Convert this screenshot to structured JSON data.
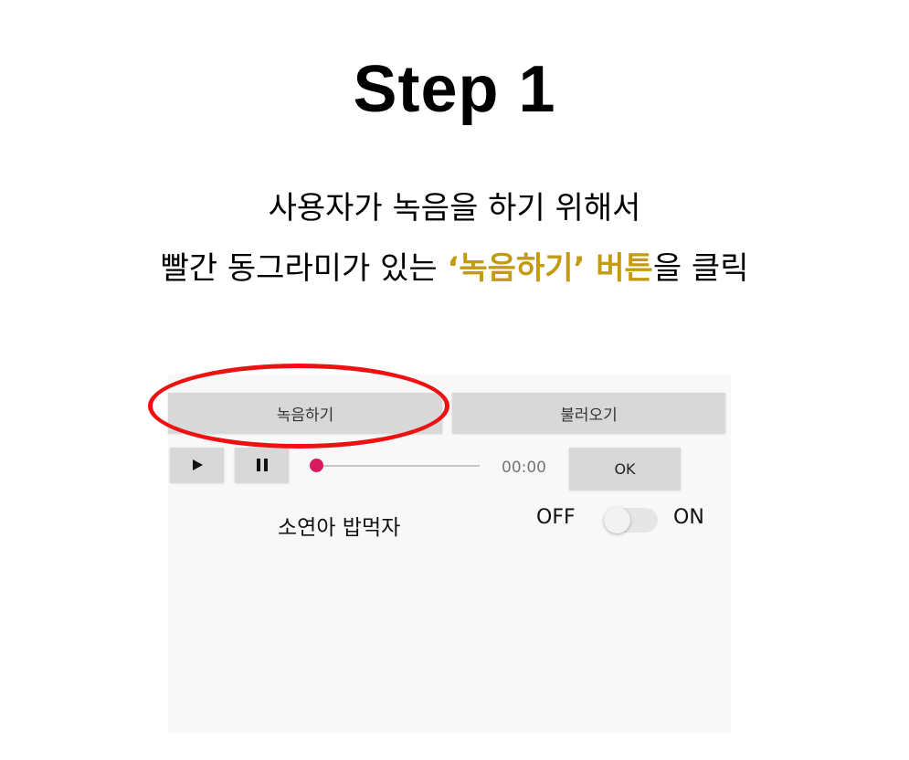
{
  "title": "Step 1",
  "instruction": {
    "line1": "사용자가 녹음을 하기 위해서",
    "line2_before": "빨간 동그라미가 있는 ",
    "line2_highlight_quote": "‘녹음하기’ 버튼",
    "line2_after": "을 클릭"
  },
  "colors": {
    "highlight": "#c39a12",
    "circle": "#ee1111",
    "seek_thumb": "#d81b60"
  },
  "app": {
    "record_button": "녹음하기",
    "load_button": "불러오기",
    "play_icon": "play-icon",
    "pause_icon": "pause-icon",
    "time": "00:00",
    "ok_button": "OK",
    "item_name": "소연아 밥먹자",
    "switch_off_label": "OFF",
    "switch_on_label": "ON",
    "switch_state": "off"
  }
}
